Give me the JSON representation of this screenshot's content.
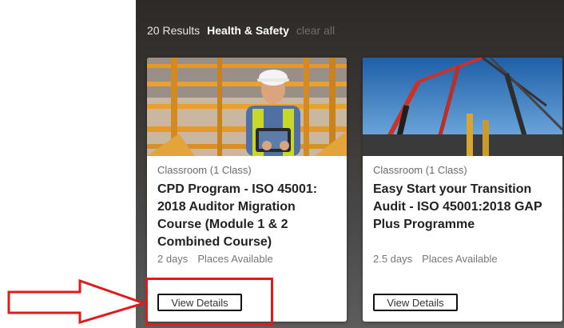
{
  "results": {
    "count_label": "20 Results",
    "filter_label": "Health & Safety",
    "clear_label": "clear all"
  },
  "cards": [
    {
      "type": "Classroom (1 Class)",
      "title": "CPD Program - ISO 45001: 2018 Auditor Migration Course (Module 1 & 2 Combined Course)",
      "duration": "2 days",
      "availability": "Places Available",
      "button_label": "View Details"
    },
    {
      "type": "Classroom (1 Class)",
      "title": "Easy Start your Transition Audit - ISO 45001:2018 GAP Plus Programme",
      "duration": "2.5 days",
      "availability": "Places Available",
      "button_label": "View Details"
    }
  ],
  "colors": {
    "panel_dark": "#2d2a27",
    "annotation_red": "#e01b1b"
  }
}
